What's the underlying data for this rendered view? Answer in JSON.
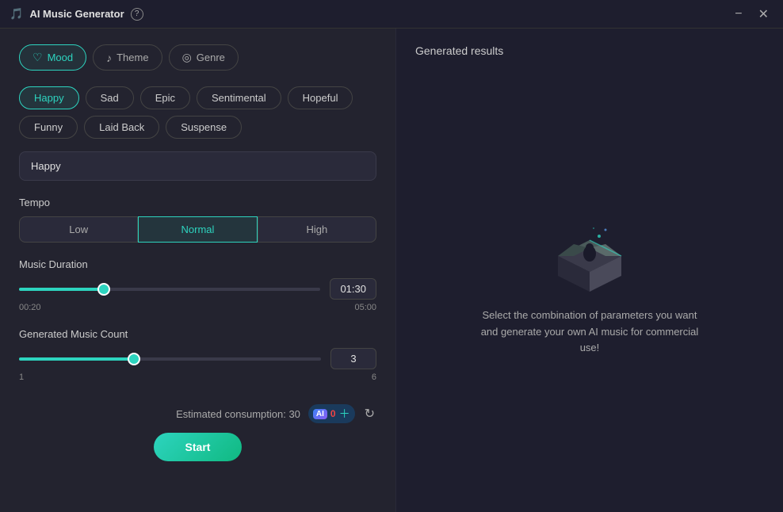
{
  "titlebar": {
    "title": "AI Music Generator",
    "help_icon": "?",
    "minimize_label": "−",
    "close_label": "✕"
  },
  "tabs": [
    {
      "id": "mood",
      "label": "Mood",
      "icon": "🎵",
      "active": true
    },
    {
      "id": "theme",
      "label": "Theme",
      "icon": "🎼",
      "active": false
    },
    {
      "id": "genre",
      "label": "Genre",
      "icon": "🎧",
      "active": false
    }
  ],
  "mood": {
    "options": [
      {
        "label": "Happy",
        "selected": true
      },
      {
        "label": "Sad",
        "selected": false
      },
      {
        "label": "Epic",
        "selected": false
      },
      {
        "label": "Sentimental",
        "selected": false
      },
      {
        "label": "Hopeful",
        "selected": false
      },
      {
        "label": "Funny",
        "selected": false
      },
      {
        "label": "Laid Back",
        "selected": false
      },
      {
        "label": "Suspense",
        "selected": false
      }
    ],
    "input_value": "Happy",
    "input_placeholder": "Happy"
  },
  "tempo": {
    "label": "Tempo",
    "options": [
      {
        "label": "Low",
        "active": false
      },
      {
        "label": "Normal",
        "active": true
      },
      {
        "label": "High",
        "active": false
      }
    ]
  },
  "music_duration": {
    "label": "Music Duration",
    "min": "00:20",
    "max": "05:00",
    "value": "01:30",
    "fill_percent": 28
  },
  "music_count": {
    "label": "Generated Music Count",
    "min": "1",
    "max": "6",
    "value": "3",
    "fill_percent": 38
  },
  "bottom": {
    "consumption_label": "Estimated consumption: 30",
    "ai_label": "AI",
    "ai_count": "0",
    "start_label": "Start"
  },
  "right_panel": {
    "title": "Generated results",
    "description": "Select the combination of parameters you want and generate your own AI music for commercial use!"
  }
}
